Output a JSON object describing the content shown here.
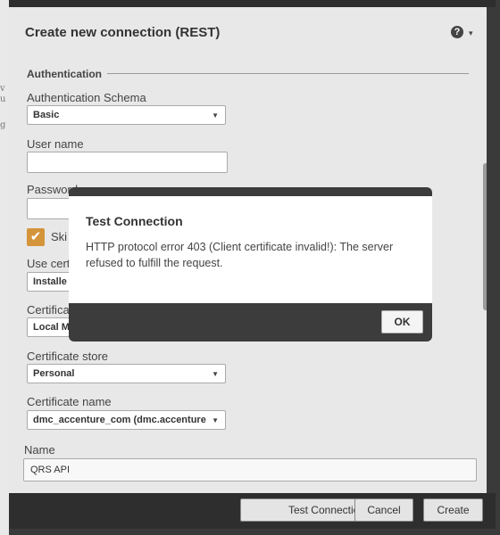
{
  "dialog": {
    "title": "Create new connection (REST)",
    "help_icon": "?",
    "caret_icon": "▾"
  },
  "background": {
    "fragments": [
      "v",
      "u",
      "g"
    ]
  },
  "form": {
    "section_authentication": "Authentication",
    "auth_schema": {
      "label": "Authentication Schema",
      "value": "Basic"
    },
    "user_name": {
      "label": "User name",
      "value": ""
    },
    "password": {
      "label": "Password",
      "value": ""
    },
    "skip_checkbox": {
      "label": "Ski",
      "checked": true
    },
    "use_certificate": {
      "label": "Use cert",
      "value": "Installe"
    },
    "certificate_location": {
      "label": "Certifica",
      "value": "Local M"
    },
    "certificate_store": {
      "label": "Certificate store",
      "value": "Personal"
    },
    "certificate_name": {
      "label": "Certificate name",
      "value": "dmc_accenture_com (dmc.accenture"
    },
    "name": {
      "label": "Name",
      "value": "QRS API"
    }
  },
  "footer": {
    "test_connection": "Test Connection",
    "cancel": "Cancel",
    "create": "Create"
  },
  "modal": {
    "title": "Test Connection",
    "message": "HTTP protocol error 403 (Client certificate invalid!):  The server refused to fulfill the request.",
    "ok": "OK"
  },
  "colors": {
    "accent_checkbox": "#d4953a",
    "dark_chrome": "#2e2e2e",
    "dialog_bg": "#e8e8e8"
  }
}
